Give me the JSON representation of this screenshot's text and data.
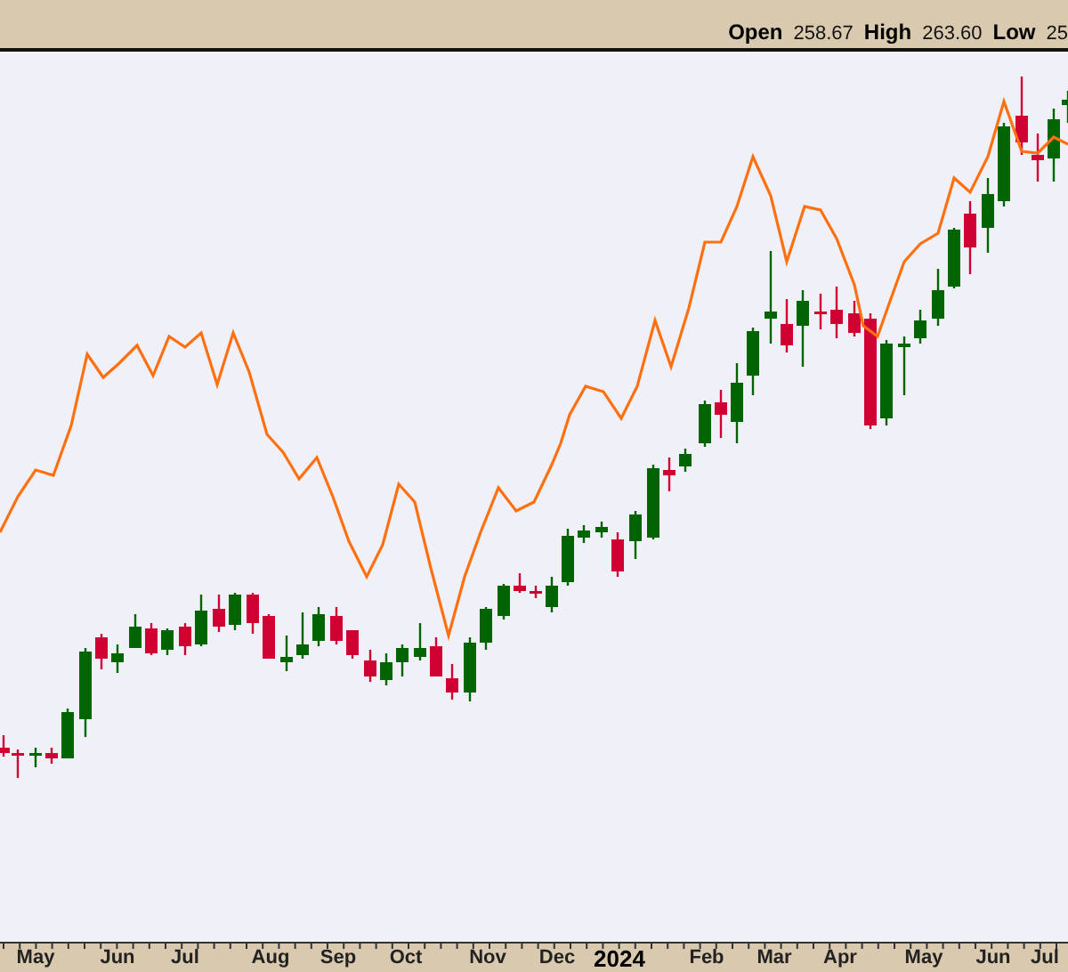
{
  "header": {
    "stats": [
      {
        "label": "Open",
        "value": "258.67"
      },
      {
        "label": "High",
        "value": "263.60"
      },
      {
        "label": "Low",
        "value": "25"
      }
    ]
  },
  "x_axis": {
    "labels": [
      {
        "text": "May",
        "kind": "month"
      },
      {
        "text": "Jun",
        "kind": "month"
      },
      {
        "text": "Jul",
        "kind": "month"
      },
      {
        "text": "Aug",
        "kind": "month"
      },
      {
        "text": "Sep",
        "kind": "month"
      },
      {
        "text": "Oct",
        "kind": "month"
      },
      {
        "text": "Nov",
        "kind": "month"
      },
      {
        "text": "Dec",
        "kind": "month"
      },
      {
        "text": "2024",
        "kind": "year"
      },
      {
        "text": "Feb",
        "kind": "month"
      },
      {
        "text": "Mar",
        "kind": "month"
      },
      {
        "text": "Apr",
        "kind": "month"
      },
      {
        "text": "May",
        "kind": "month"
      },
      {
        "text": "Jun",
        "kind": "month"
      },
      {
        "text": "Jul",
        "kind": "month"
      }
    ]
  }
}
